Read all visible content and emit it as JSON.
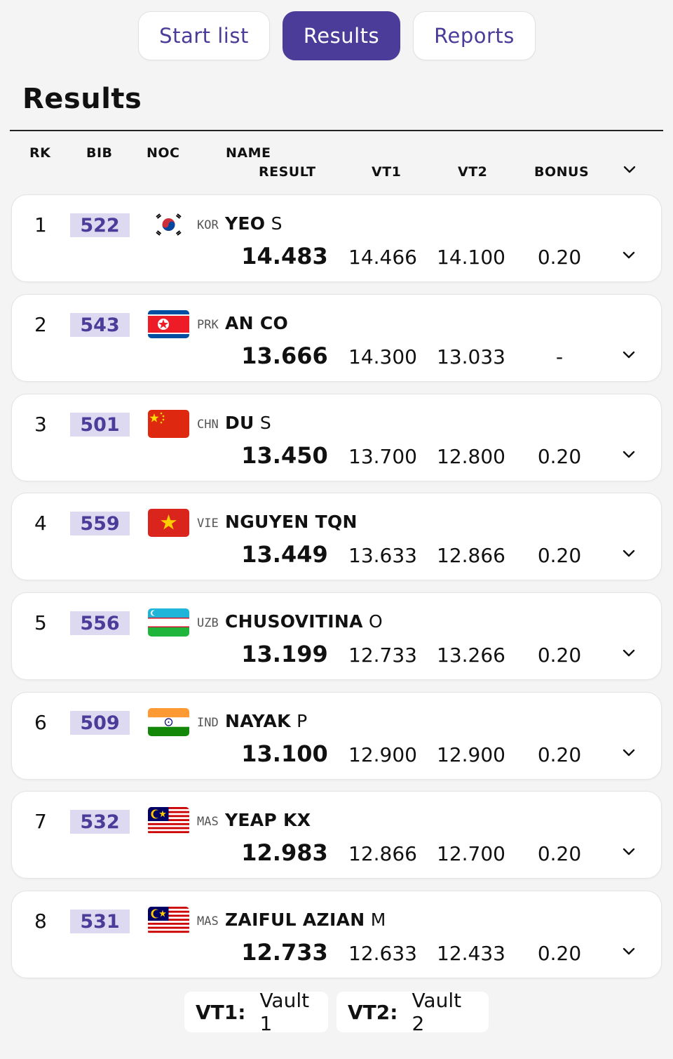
{
  "tabs": [
    {
      "label": "Start list",
      "active": false
    },
    {
      "label": "Results",
      "active": true
    },
    {
      "label": "Reports",
      "active": false
    }
  ],
  "page_title": "Results",
  "columns": {
    "rk": "RK",
    "bib": "BIB",
    "noc": "NOC",
    "name": "NAME",
    "result": "RESULT",
    "vt1": "VT1",
    "vt2": "VT2",
    "bonus": "BONUS"
  },
  "rows": [
    {
      "rk": "1",
      "bib": "522",
      "noc": "KOR",
      "surname": "YEO",
      "given": "S",
      "result": "14.483",
      "vt1": "14.466",
      "vt2": "14.100",
      "bonus": "0.20"
    },
    {
      "rk": "2",
      "bib": "543",
      "noc": "PRK",
      "surname": "AN CO",
      "given": "",
      "result": "13.666",
      "vt1": "14.300",
      "vt2": "13.033",
      "bonus": "-"
    },
    {
      "rk": "3",
      "bib": "501",
      "noc": "CHN",
      "surname": "DU",
      "given": "S",
      "result": "13.450",
      "vt1": "13.700",
      "vt2": "12.800",
      "bonus": "0.20"
    },
    {
      "rk": "4",
      "bib": "559",
      "noc": "VIE",
      "surname": "NGUYEN TQN",
      "given": "",
      "result": "13.449",
      "vt1": "13.633",
      "vt2": "12.866",
      "bonus": "0.20"
    },
    {
      "rk": "5",
      "bib": "556",
      "noc": "UZB",
      "surname": "CHUSOVITINA",
      "given": "O",
      "result": "13.199",
      "vt1": "12.733",
      "vt2": "13.266",
      "bonus": "0.20"
    },
    {
      "rk": "6",
      "bib": "509",
      "noc": "IND",
      "surname": "NAYAK",
      "given": "P",
      "result": "13.100",
      "vt1": "12.900",
      "vt2": "12.900",
      "bonus": "0.20"
    },
    {
      "rk": "7",
      "bib": "532",
      "noc": "MAS",
      "surname": "YEAP KX",
      "given": "",
      "result": "12.983",
      "vt1": "12.866",
      "vt2": "12.700",
      "bonus": "0.20"
    },
    {
      "rk": "8",
      "bib": "531",
      "noc": "MAS",
      "surname": "ZAIFUL AZIAN",
      "given": "M",
      "result": "12.733",
      "vt1": "12.633",
      "vt2": "12.433",
      "bonus": "0.20"
    }
  ],
  "legend": [
    {
      "abbr": "VT1:",
      "label": "Vault 1"
    },
    {
      "abbr": "VT2:",
      "label": "Vault 2"
    }
  ],
  "colors": {
    "accent": "#4b3c9a",
    "bib_bg": "#ddd9f0",
    "page_bg": "#f4f4f4"
  },
  "icons": {
    "row_expand": "chevron-down-icon",
    "header_expand": "chevron-down-icon"
  }
}
